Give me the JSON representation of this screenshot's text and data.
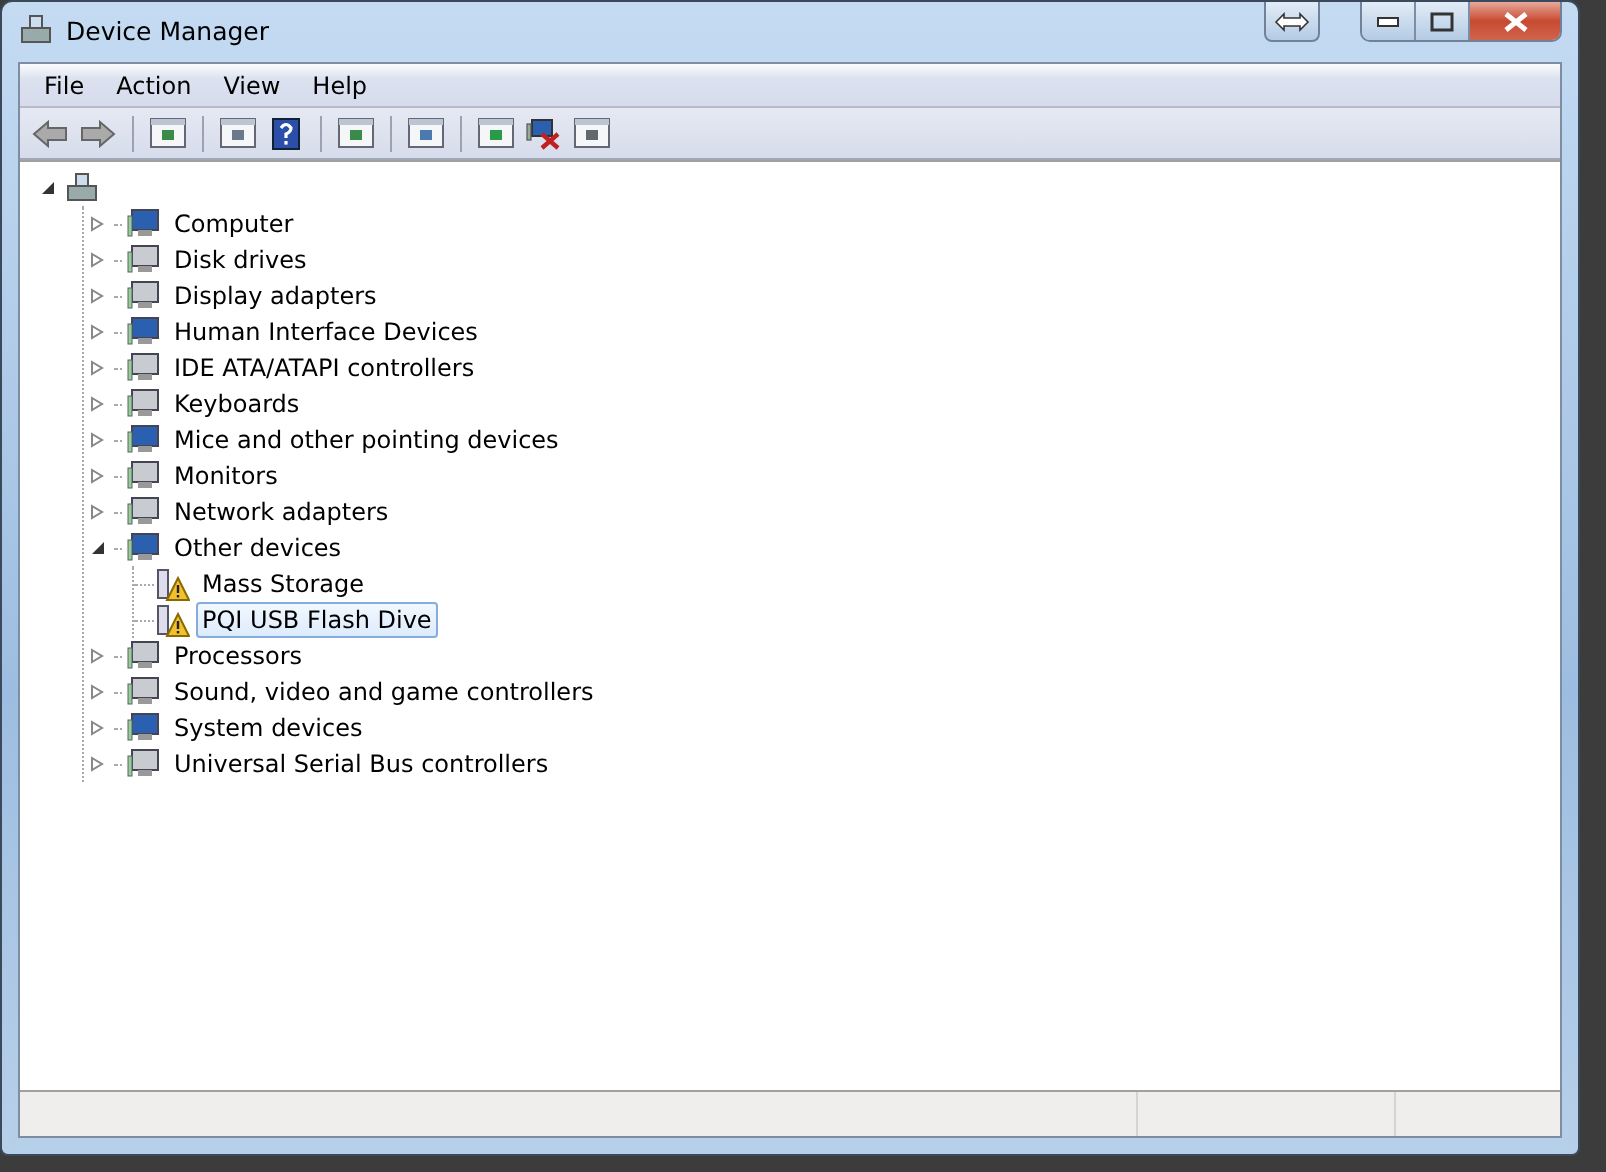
{
  "window": {
    "title": "Device Manager"
  },
  "menu": [
    "File",
    "Action",
    "View",
    "Help"
  ],
  "toolbar": [
    {
      "disabled": true
    },
    {
      "disabled": true
    },
    {
      "disabled": false
    },
    {
      "disabled": false
    },
    {
      "disabled": false
    },
    {
      "disabled": false
    },
    {
      "disabled": false
    },
    {
      "disabled": false
    },
    {
      "disabled": false
    },
    {
      "disabled": false
    }
  ],
  "tree": {
    "expanded": true,
    "children": [
      {
        "label": "Computer",
        "expanded": false
      },
      {
        "label": "Disk drives",
        "expanded": false
      },
      {
        "label": "Display adapters",
        "expanded": false
      },
      {
        "label": "Human Interface Devices",
        "expanded": false
      },
      {
        "label": "IDE ATA/ATAPI controllers",
        "expanded": false
      },
      {
        "label": "Keyboards",
        "expanded": false
      },
      {
        "label": "Mice and other pointing devices",
        "expanded": false
      },
      {
        "label": "Monitors",
        "expanded": false
      },
      {
        "label": "Network adapters",
        "expanded": false
      },
      {
        "label": "Other devices",
        "expanded": true,
        "children": [
          {
            "label": "Mass Storage",
            "warning": true,
            "selected": false
          },
          {
            "label": "PQI USB Flash Dive",
            "warning": true,
            "selected": true
          }
        ]
      },
      {
        "label": "Processors",
        "expanded": false
      },
      {
        "label": "Sound, video and game controllers",
        "expanded": false
      },
      {
        "label": "System devices",
        "expanded": false
      },
      {
        "label": "Universal Serial Bus controllers",
        "expanded": false
      }
    ]
  }
}
